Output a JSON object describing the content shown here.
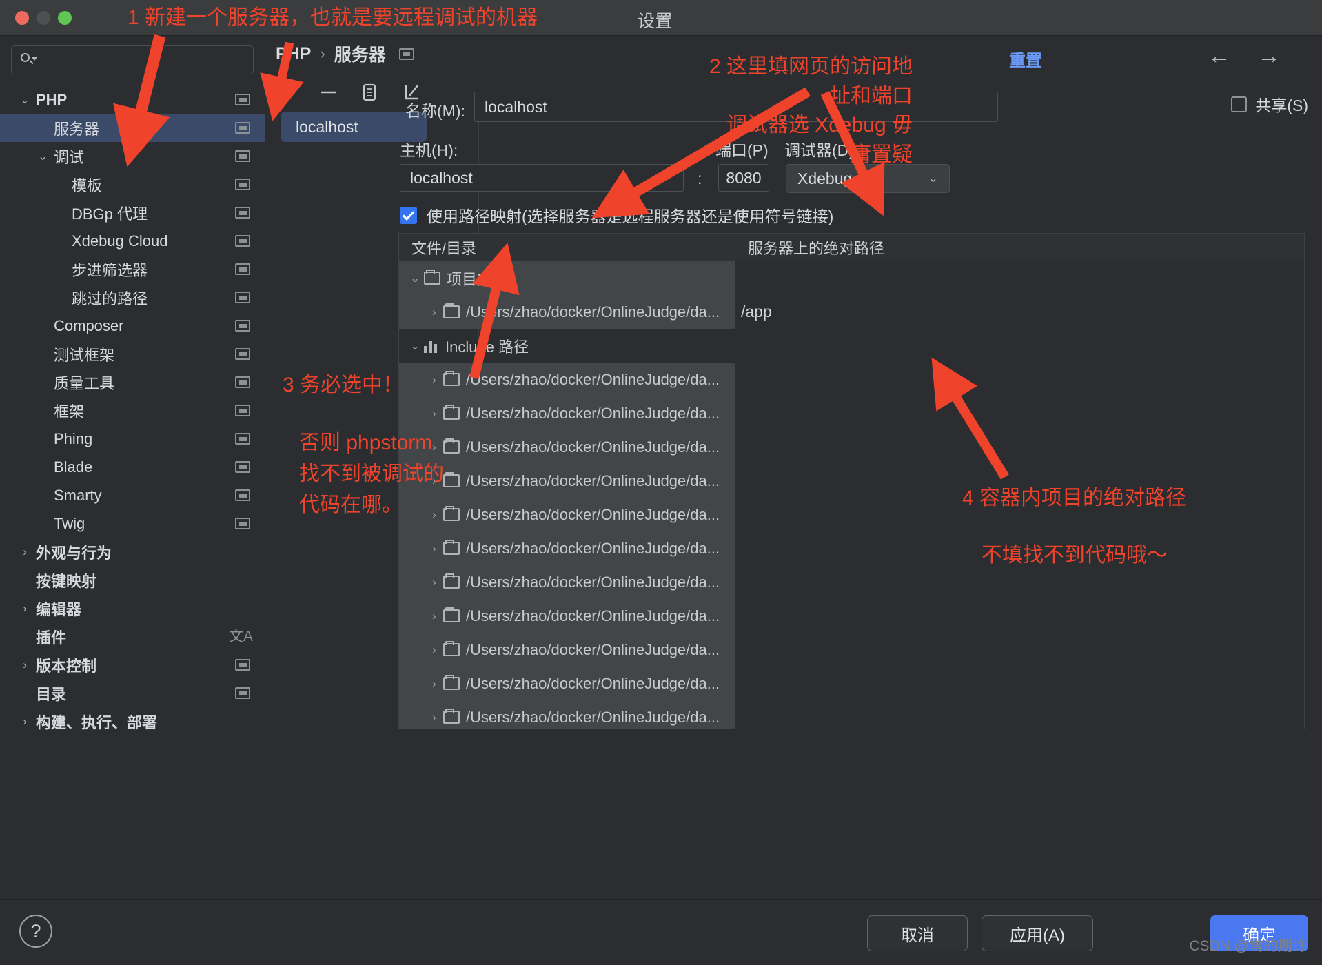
{
  "window": {
    "title": "设置",
    "traffic_lights": [
      "close",
      "minimize",
      "zoom"
    ]
  },
  "sidebar": {
    "search": {
      "value": "",
      "placeholder": ""
    },
    "items": [
      {
        "label": "PHP",
        "level": 0,
        "chevron": "down",
        "icon": "settings-indicator",
        "selected": false
      },
      {
        "label": "服务器",
        "level": 1,
        "chevron": "",
        "icon": "settings-indicator",
        "selected": true
      },
      {
        "label": "调试",
        "level": 1,
        "chevron": "down",
        "icon": "settings-indicator",
        "selected": false
      },
      {
        "label": "模板",
        "level": 2,
        "chevron": "",
        "icon": "settings-indicator",
        "selected": false
      },
      {
        "label": "DBGp 代理",
        "level": 2,
        "chevron": "",
        "icon": "settings-indicator",
        "selected": false
      },
      {
        "label": "Xdebug Cloud",
        "level": 2,
        "chevron": "",
        "icon": "settings-indicator",
        "selected": false
      },
      {
        "label": "步进筛选器",
        "level": 2,
        "chevron": "",
        "icon": "settings-indicator",
        "selected": false
      },
      {
        "label": "跳过的路径",
        "level": 2,
        "chevron": "",
        "icon": "settings-indicator",
        "selected": false
      },
      {
        "label": "Composer",
        "level": 1,
        "chevron": "",
        "icon": "settings-indicator",
        "selected": false
      },
      {
        "label": "测试框架",
        "level": 1,
        "chevron": "",
        "icon": "settings-indicator",
        "selected": false
      },
      {
        "label": "质量工具",
        "level": 1,
        "chevron": "",
        "icon": "settings-indicator",
        "selected": false
      },
      {
        "label": "框架",
        "level": 1,
        "chevron": "",
        "icon": "settings-indicator",
        "selected": false
      },
      {
        "label": "Phing",
        "level": 1,
        "chevron": "",
        "icon": "settings-indicator",
        "selected": false
      },
      {
        "label": "Blade",
        "level": 1,
        "chevron": "",
        "icon": "settings-indicator",
        "selected": false
      },
      {
        "label": "Smarty",
        "level": 1,
        "chevron": "",
        "icon": "settings-indicator",
        "selected": false
      },
      {
        "label": "Twig",
        "level": 1,
        "chevron": "",
        "icon": "settings-indicator",
        "selected": false
      },
      {
        "label": "外观与行为",
        "level": 0,
        "chevron": "right",
        "icon": "",
        "selected": false
      },
      {
        "label": "按键映射",
        "level": 0,
        "chevron": "",
        "icon": "",
        "selected": false
      },
      {
        "label": "编辑器",
        "level": 0,
        "chevron": "right",
        "icon": "",
        "selected": false
      },
      {
        "label": "插件",
        "level": 0,
        "chevron": "",
        "icon": "translate",
        "selected": false
      },
      {
        "label": "版本控制",
        "level": 0,
        "chevron": "right",
        "icon": "settings-indicator",
        "selected": false
      },
      {
        "label": "目录",
        "level": 0,
        "chevron": "",
        "icon": "settings-indicator",
        "selected": false
      },
      {
        "label": "构建、执行、部署",
        "level": 0,
        "chevron": "right",
        "icon": "",
        "selected": false
      }
    ]
  },
  "breadcrumb": {
    "root": "PHP",
    "separator": "›",
    "current": "服务器"
  },
  "list_toolbar": {
    "add": "+",
    "remove": "−",
    "copy": "copy-icon",
    "import": "import-icon"
  },
  "server_list": {
    "items": [
      "localhost"
    ],
    "selected": "localhost"
  },
  "header_actions": {
    "reset": "重置",
    "back": "←",
    "forward": "→",
    "share_label": "共享(S)",
    "share_checked": false
  },
  "form": {
    "name_label": "名称(M):",
    "name_value": "localhost",
    "host_label": "主机(H):",
    "host_value": "localhost",
    "colon": ":",
    "port_label": "端口(P)",
    "port_value": "8080",
    "debugger_label": "调试器(D)",
    "debugger_value": "Xdebug",
    "debugger_options": [
      "Xdebug"
    ],
    "path_mapping_label": "使用路径映射(选择服务器是远程服务器还是使用符号链接)",
    "path_mapping_checked": true
  },
  "mapping_table": {
    "columns": [
      "文件/目录",
      "服务器上的绝对路径"
    ],
    "rows": [
      {
        "label": "项目文件",
        "icon": "folder-icon",
        "chevron": "down",
        "indent": 0,
        "shaded": true,
        "mapped": ""
      },
      {
        "label": "/Users/zhao/docker/OnlineJudge/da...",
        "icon": "folder-icon",
        "chevron": "right",
        "indent": 1,
        "shaded": true,
        "mapped": "/app"
      },
      {
        "label": "Include 路径",
        "icon": "include-icon",
        "chevron": "down",
        "indent": 0,
        "shaded": false,
        "mapped": ""
      },
      {
        "label": "/Users/zhao/docker/OnlineJudge/da...",
        "icon": "folder-icon",
        "chevron": "right",
        "indent": 1,
        "shaded": true,
        "mapped": ""
      },
      {
        "label": "/Users/zhao/docker/OnlineJudge/da...",
        "icon": "folder-icon",
        "chevron": "right",
        "indent": 1,
        "shaded": true,
        "mapped": ""
      },
      {
        "label": "/Users/zhao/docker/OnlineJudge/da...",
        "icon": "folder-icon",
        "chevron": "right",
        "indent": 1,
        "shaded": true,
        "mapped": ""
      },
      {
        "label": "/Users/zhao/docker/OnlineJudge/da...",
        "icon": "folder-icon",
        "chevron": "right",
        "indent": 1,
        "shaded": true,
        "mapped": ""
      },
      {
        "label": "/Users/zhao/docker/OnlineJudge/da...",
        "icon": "folder-icon",
        "chevron": "right",
        "indent": 1,
        "shaded": true,
        "mapped": ""
      },
      {
        "label": "/Users/zhao/docker/OnlineJudge/da...",
        "icon": "folder-icon",
        "chevron": "right",
        "indent": 1,
        "shaded": true,
        "mapped": ""
      },
      {
        "label": "/Users/zhao/docker/OnlineJudge/da...",
        "icon": "folder-icon",
        "chevron": "right",
        "indent": 1,
        "shaded": true,
        "mapped": ""
      },
      {
        "label": "/Users/zhao/docker/OnlineJudge/da...",
        "icon": "folder-icon",
        "chevron": "right",
        "indent": 1,
        "shaded": true,
        "mapped": ""
      },
      {
        "label": "/Users/zhao/docker/OnlineJudge/da...",
        "icon": "folder-icon",
        "chevron": "right",
        "indent": 1,
        "shaded": true,
        "mapped": ""
      },
      {
        "label": "/Users/zhao/docker/OnlineJudge/da...",
        "icon": "folder-icon",
        "chevron": "right",
        "indent": 1,
        "shaded": true,
        "mapped": ""
      },
      {
        "label": "/Users/zhao/docker/OnlineJudge/da...",
        "icon": "folder-icon",
        "chevron": "right",
        "indent": 1,
        "shaded": true,
        "mapped": ""
      }
    ]
  },
  "footer": {
    "help": "?",
    "cancel": "取消",
    "apply": "应用(A)",
    "ok": "确定"
  },
  "watermark": "CSDN @雪的期许",
  "annotations": {
    "a1": "1 新建一个服务器，也就是要远程调试的机器",
    "a2": "2 这里填网页的访问地址和端口\n调试器选 Xdebug 毋庸置疑",
    "a3": "3 务必选中！",
    "a4": "否则 phpstorm\n找不到被调试的\n代码在哪。",
    "a5": "4 容器内项目的绝对路径",
    "a6": "不填找不到代码哦～"
  },
  "colors": {
    "accent_blue": "#4a78f0",
    "selection_blue": "#3b4a68",
    "annotation_red": "#f0432b",
    "link_blue": "#6b9bf7",
    "window_bg": "#2b2d30"
  }
}
